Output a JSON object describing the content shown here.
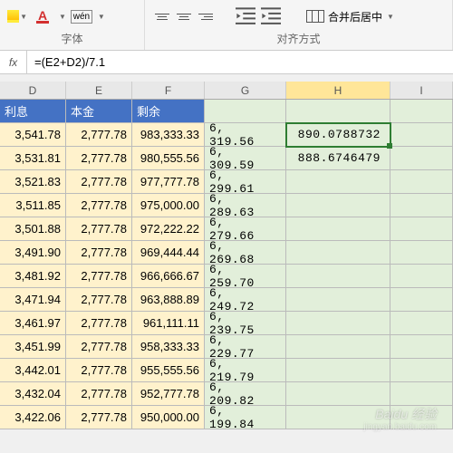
{
  "ribbon": {
    "font_group_label": "字体",
    "align_group_label": "对齐方式",
    "wen_label": "wén",
    "merge_label": "合并后居中"
  },
  "formula_bar": {
    "fx": "fx",
    "formula": "=(E2+D2)/7.1"
  },
  "columns": [
    "D",
    "E",
    "F",
    "G",
    "H",
    "I"
  ],
  "active_column": "H",
  "headers": {
    "d": "利息",
    "e": "本金",
    "f": "剩余"
  },
  "rows": [
    {
      "d": "3,541.78",
      "e": "2,777.78",
      "f": "983,333.33",
      "g": "6,319.56",
      "h": "890.0788732"
    },
    {
      "d": "3,531.81",
      "e": "2,777.78",
      "f": "980,555.56",
      "g": "6,309.59",
      "h": "888.6746479"
    },
    {
      "d": "3,521.83",
      "e": "2,777.78",
      "f": "977,777.78",
      "g": "6,299.61",
      "h": ""
    },
    {
      "d": "3,511.85",
      "e": "2,777.78",
      "f": "975,000.00",
      "g": "6,289.63",
      "h": ""
    },
    {
      "d": "3,501.88",
      "e": "2,777.78",
      "f": "972,222.22",
      "g": "6,279.66",
      "h": ""
    },
    {
      "d": "3,491.90",
      "e": "2,777.78",
      "f": "969,444.44",
      "g": "6,269.68",
      "h": ""
    },
    {
      "d": "3,481.92",
      "e": "2,777.78",
      "f": "966,666.67",
      "g": "6,259.70",
      "h": ""
    },
    {
      "d": "3,471.94",
      "e": "2,777.78",
      "f": "963,888.89",
      "g": "6,249.72",
      "h": ""
    },
    {
      "d": "3,461.97",
      "e": "2,777.78",
      "f": "961,111.11",
      "g": "6,239.75",
      "h": ""
    },
    {
      "d": "3,451.99",
      "e": "2,777.78",
      "f": "958,333.33",
      "g": "6,229.77",
      "h": ""
    },
    {
      "d": "3,442.01",
      "e": "2,777.78",
      "f": "955,555.56",
      "g": "6,219.79",
      "h": ""
    },
    {
      "d": "3,432.04",
      "e": "2,777.78",
      "f": "952,777.78",
      "g": "6,209.82",
      "h": ""
    },
    {
      "d": "3,422.06",
      "e": "2,777.78",
      "f": "950,000.00",
      "g": "6,199.84",
      "h": ""
    }
  ],
  "selected_cell": "H2",
  "watermark": {
    "line1": "Baidu 经验",
    "line2": "jingyan.baidu.com"
  }
}
